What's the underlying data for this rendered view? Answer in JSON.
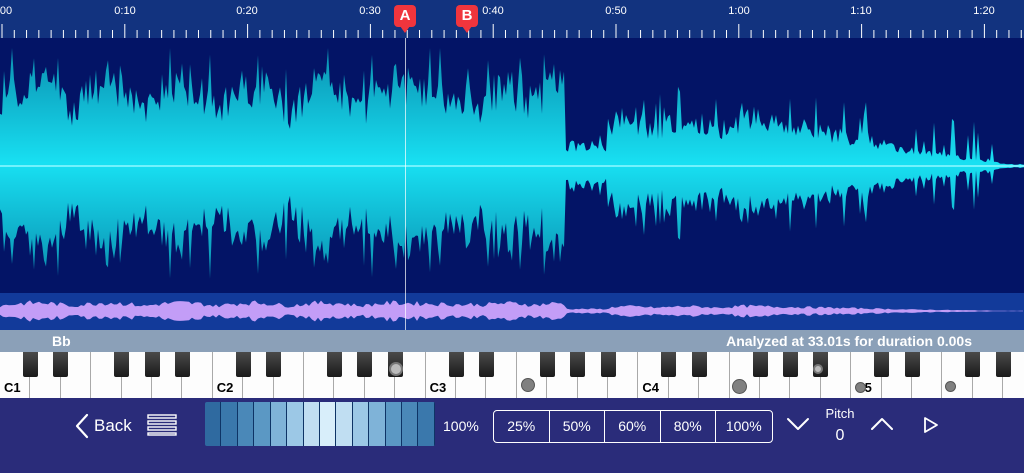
{
  "timeline": {
    "ticks": [
      {
        "label": "00",
        "seconds": 0
      },
      {
        "label": "0:10",
        "seconds": 10
      },
      {
        "label": "0:20",
        "seconds": 20
      },
      {
        "label": "0:30",
        "seconds": 30
      },
      {
        "label": "0:40",
        "seconds": 40
      },
      {
        "label": "0:50",
        "seconds": 50
      },
      {
        "label": "1:00",
        "seconds": 60
      },
      {
        "label": "1:10",
        "seconds": 70
      },
      {
        "label": "1:20",
        "seconds": 80
      }
    ],
    "marker_a": {
      "label": "A"
    },
    "marker_b": {
      "label": "B"
    }
  },
  "colors": {
    "waveform": "#18e0f2",
    "overview_wave": "#c39df7",
    "marker": "#f0353d",
    "background": "#031466"
  },
  "note_bar": {
    "note": "Bb",
    "analysis": "Analyzed at 33.01s for duration 0.00s"
  },
  "piano": {
    "octave_labels": [
      "C1",
      "C2",
      "C3",
      "C4",
      "C5"
    ]
  },
  "controls": {
    "back_label": "Back",
    "list_icon": "list-icon",
    "speed_value": "100%",
    "speed_presets": [
      "25%",
      "50%",
      "60%",
      "80%",
      "100%"
    ],
    "pitch_label": "Pitch",
    "pitch_value": "0",
    "pitch_down_icon": "chevron-down-icon",
    "pitch_up_icon": "chevron-up-icon",
    "play_icon": "play-icon"
  }
}
